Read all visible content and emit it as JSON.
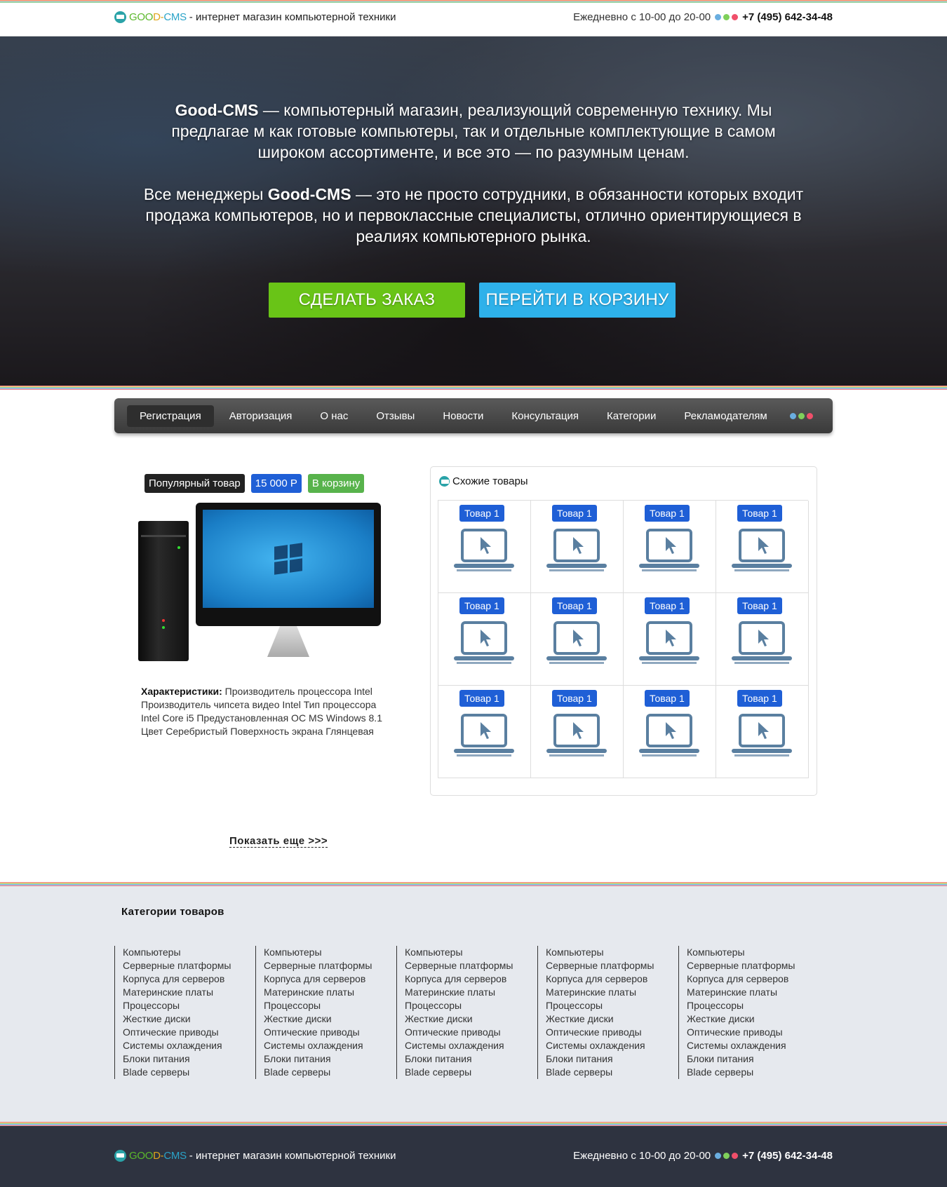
{
  "header": {
    "brand": {
      "p1": "GOO",
      "p2": "D-",
      "p3": "CMS"
    },
    "subtitle": "- интернет магазин компьютерной техники",
    "hours": "Ежедневно с 10-00 до 20-00",
    "phone": "+7 (495) 642-34-48",
    "dot_colors": [
      "#6aaee0",
      "#7fd05a",
      "#f04f6a"
    ]
  },
  "hero": {
    "p1_bold": "Good-CMS",
    "p1_rest": " — компьютерный магазин, реализующий современную технику. Мы предлагае м как готовые компьютеры, так и отдельные комплектующие в самом широком ассортименте, и все это — по разумным ценам.",
    "p2_pre": "Все менеджеры ",
    "p2_bold": "Good-CMS",
    "p2_rest": " — это не просто сотрудники, в обязанности которых входит продажа компьютеров, но и первоклассные специалисты, отлично ориентирующиеся в реалиях компьютерного рынка.",
    "btn_order": "СДЕЛАТЬ ЗАКАЗ",
    "btn_cart": "ПЕРЕЙТИ В КОРЗИНУ"
  },
  "nav": {
    "items": [
      "Регистрация",
      "Авторизация",
      "О нас",
      "Отзывы",
      "Новости",
      "Консультация",
      "Категории",
      "Рекламодателям"
    ]
  },
  "product": {
    "badge_popular": "Популярный товар",
    "price": "15 000 Р",
    "add_to_cart": "В корзину",
    "specs_label": "Характеристики:",
    "specs_text": " Производитель процессора Intel Производитель чипсета видео Intel Тип процессора Intel Core i5 Предустановленная ОС MS Windows 8.1 Цвет Серебристый Поверхность экрана Глянцевая"
  },
  "similar": {
    "title": "Схожие товары",
    "items": [
      "Товар 1",
      "Товар 1",
      "Товар 1",
      "Товар 1",
      "Товар 1",
      "Товар 1",
      "Товар 1",
      "Товар 1",
      "Товар 1",
      "Товар 1",
      "Товар 1",
      "Товар 1"
    ]
  },
  "show_more": "Показать еще >>>",
  "categories": {
    "title": "Категории товаров",
    "column": [
      "Компьютеры",
      "Серверные платформы",
      "Корпуса для серверов",
      "Материнские платы",
      "Процессоры",
      "Жесткие диски",
      "Оптические приводы",
      "Системы охлаждения",
      "Блоки питания",
      "Blade серверы"
    ]
  },
  "footer": {
    "brand": {
      "p1": "GOO",
      "p2": "D-",
      "p3": "CMS"
    },
    "subtitle": "- интернет магазин компьютерной техники",
    "hours": "Ежедневно с 10-00 до 20-00",
    "phone": "+7 (495) 642-34-48"
  }
}
